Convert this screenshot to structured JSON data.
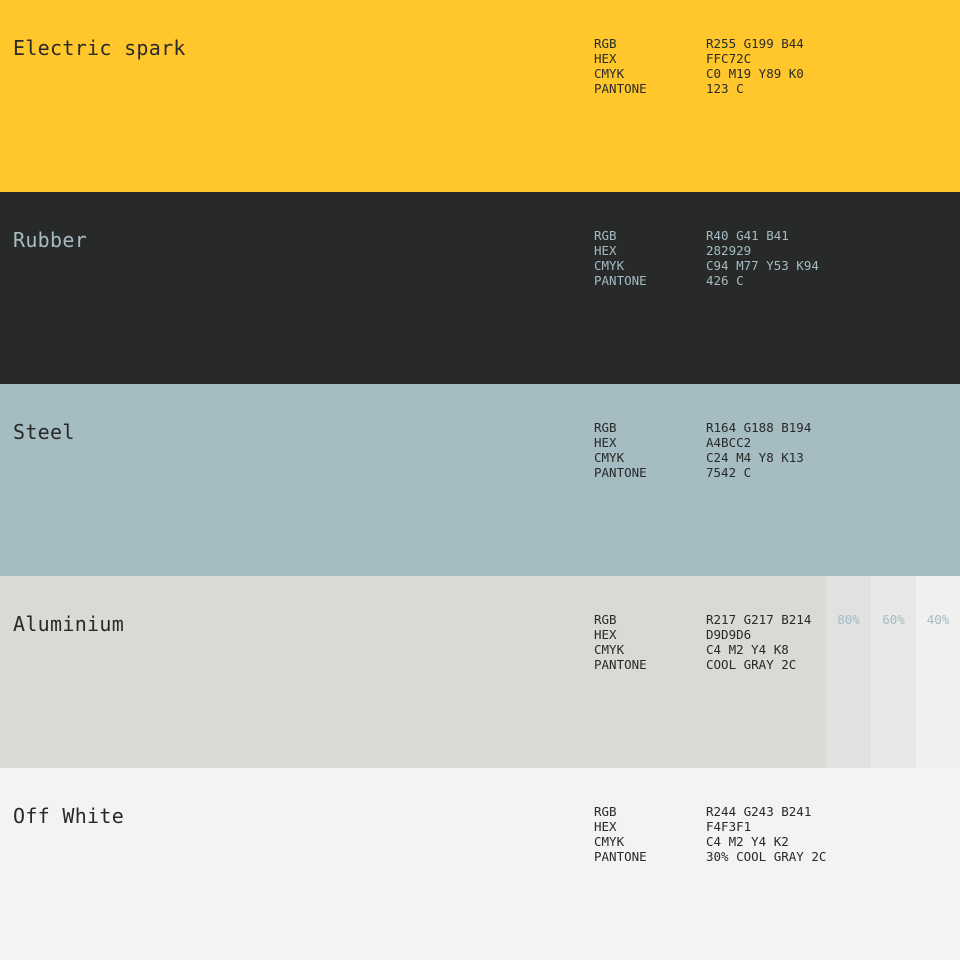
{
  "colors": [
    {
      "name": "Electric spark",
      "bg": "#FFC72C",
      "text_color": "#2b2b2b",
      "rgb": "R255 G199 B44",
      "hex": "FFC72C",
      "cmyk": "C0 M19 Y89 K0",
      "pantone": "123 C"
    },
    {
      "name": "Rubber",
      "bg": "#282929",
      "text_color": "#a4bcc2",
      "rgb": "R40 G41 B41",
      "hex": "282929",
      "cmyk": "C94 M77 Y53 K94",
      "pantone": "426 C"
    },
    {
      "name": "Steel",
      "bg": "#A4BCC2",
      "text_color": "#282929",
      "rgb": "R164 G188 B194",
      "hex": "A4BCC2",
      "cmyk": "C24 M4 Y8 K13",
      "pantone": "7542 C"
    },
    {
      "name": "Aluminium",
      "bg": "#D9D9D6",
      "text_color": "#282929",
      "rgb": "R217 G217 B214",
      "hex": "D9D9D6",
      "cmyk": "C4 M2 Y4 K8",
      "pantone": "COOL GRAY 2C",
      "tints": [
        {
          "label": "80%",
          "bg": "#E1E1DF"
        },
        {
          "label": "60%",
          "bg": "#E8E8E6"
        },
        {
          "label": "40%",
          "bg": "#F0F0EF"
        }
      ],
      "tint_text_color": "#A4BCC2"
    },
    {
      "name": "Off White",
      "bg": "#F4F3F1",
      "text_color": "#282929",
      "rgb": "R244 G243 B241",
      "hex": "F4F3F1",
      "cmyk": "C4 M2 Y4 K2",
      "pantone": "30% COOL GRAY 2C"
    }
  ],
  "spec_labels": {
    "rgb": "RGB",
    "hex": "HEX",
    "cmyk": "CMYK",
    "pantone": "PANTONE"
  }
}
